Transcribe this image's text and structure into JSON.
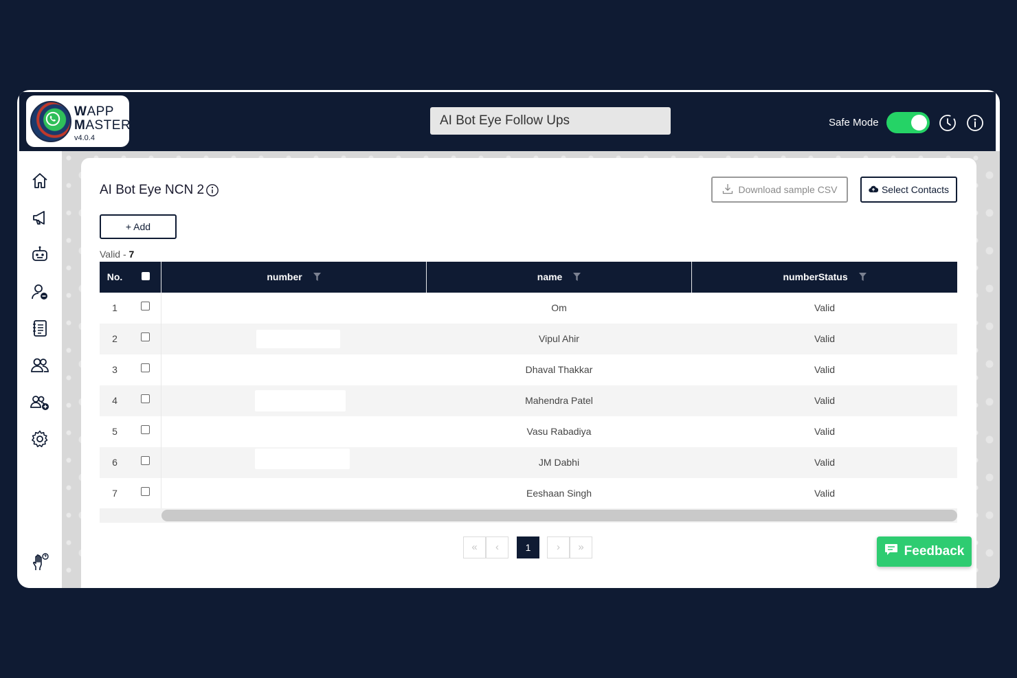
{
  "app": {
    "logo_line1_initial": "W",
    "logo_line1_rest": "APP",
    "logo_line2_initial": "M",
    "logo_line2_rest": "ASTER",
    "version": "v4.0.4"
  },
  "header": {
    "title": "AI Bot Eye Follow Ups",
    "safe_mode_label": "Safe Mode",
    "safe_mode_on": true
  },
  "sidebar": {
    "items": [
      {
        "icon": "home-icon"
      },
      {
        "icon": "megaphone-icon"
      },
      {
        "icon": "robot-icon"
      },
      {
        "icon": "user-minus-icon"
      },
      {
        "icon": "notebook-icon"
      },
      {
        "icon": "users-icon"
      },
      {
        "icon": "users-add-icon"
      },
      {
        "icon": "gear-icon"
      }
    ],
    "help_icon": "hand-help-icon"
  },
  "page": {
    "title": "AI Bot Eye NCN 2",
    "download_csv_label": "Download sample CSV",
    "select_contacts_label": "Select Contacts",
    "add_label": "+ Add",
    "valid_label": "Valid - ",
    "valid_count": "7"
  },
  "table": {
    "headers": {
      "no": "No.",
      "number": "number",
      "name": "name",
      "status": "numberStatus"
    },
    "rows": [
      {
        "no": "1",
        "number": "",
        "name": "Om",
        "status": "Valid"
      },
      {
        "no": "2",
        "number": "",
        "name": "Vipul Ahir",
        "status": "Valid"
      },
      {
        "no": "3",
        "number": "",
        "name": "Dhaval Thakkar",
        "status": "Valid"
      },
      {
        "no": "4",
        "number": "",
        "name": "Mahendra Patel",
        "status": "Valid"
      },
      {
        "no": "5",
        "number": "",
        "name": "Vasu Rabadiya",
        "status": "Valid"
      },
      {
        "no": "6",
        "number": "",
        "name": "JM Dabhi",
        "status": "Valid"
      },
      {
        "no": "7",
        "number": "",
        "name": "Eeshaan Singh",
        "status": "Valid"
      }
    ]
  },
  "pagination": {
    "first": "«",
    "prev": "‹",
    "current": "1",
    "next": "›",
    "last": "»"
  },
  "feedback": {
    "label": "Feedback"
  },
  "colors": {
    "navy": "#0f1b33",
    "accent_green": "#25d366",
    "feedback_green": "#2ecc71"
  }
}
